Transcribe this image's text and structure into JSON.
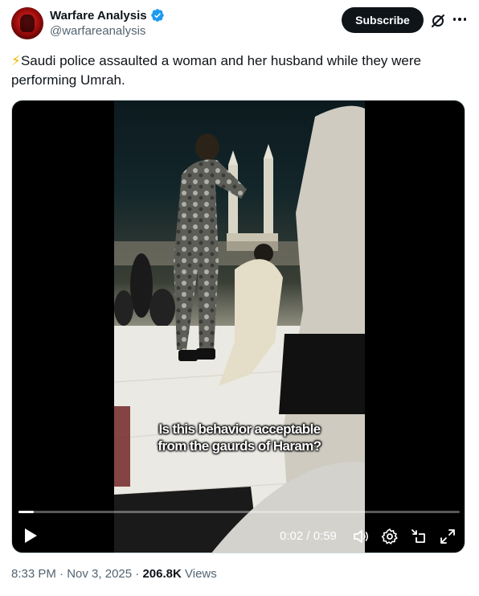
{
  "author": {
    "display_name": "Warfare Analysis",
    "handle": "@warfareanalysis",
    "verified": true,
    "avatar_color": "#c0121a"
  },
  "actions": {
    "subscribe_label": "Subscribe",
    "grok_icon": "grok-icon",
    "more_icon": "more-icon"
  },
  "tweet": {
    "emoji": "⚡",
    "text": "Saudi police assaulted a woman and her husband while they were performing Umrah."
  },
  "video": {
    "caption_line1": "Is this behavior acceptable",
    "caption_line2": "from the gaurds of Haram?",
    "current_time": "0:02",
    "duration": "0:59",
    "time_display": "0:02 / 0:59",
    "progress_fraction": 0.034,
    "controls": [
      "play-icon",
      "volume-icon",
      "settings-icon",
      "fullscreen-exit-icon",
      "expand-icon"
    ]
  },
  "meta": {
    "time": "8:33 PM",
    "date": "Nov 3, 2025",
    "views_count": "206.8K",
    "views_label": "Views",
    "separator": "·"
  },
  "colors": {
    "text_primary": "#0f1419",
    "text_secondary": "#536471",
    "verified_blue": "#1d9bf0",
    "button_dark": "#0f1419"
  }
}
